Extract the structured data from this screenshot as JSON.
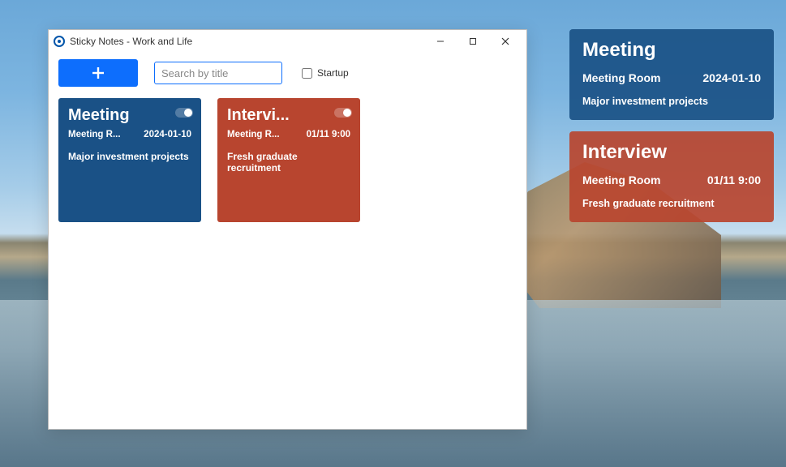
{
  "window": {
    "title": "Sticky Notes - Work and Life"
  },
  "toolbar": {
    "search_placeholder": "Search by title",
    "startup_label": "Startup"
  },
  "cards": [
    {
      "title": "Meeting",
      "location": "Meeting R...",
      "time": "2024-01-10",
      "body": "Major investment projects",
      "color": "blue"
    },
    {
      "title": "Intervi...",
      "location": "Meeting R...",
      "time": "01/11 9:00",
      "body": "Fresh graduate recruitment",
      "color": "red"
    }
  ],
  "stickies": [
    {
      "title": "Meeting",
      "location": "Meeting Room",
      "time": "2024-01-10",
      "body": "Major investment projects",
      "color": "blue"
    },
    {
      "title": "Interview",
      "location": "Meeting Room",
      "time": "01/11 9:00",
      "body": "Fresh graduate recruitment",
      "color": "red"
    }
  ],
  "colors": {
    "blue": "#1a5186",
    "red": "#b8452f",
    "accent": "#0d6efd"
  }
}
